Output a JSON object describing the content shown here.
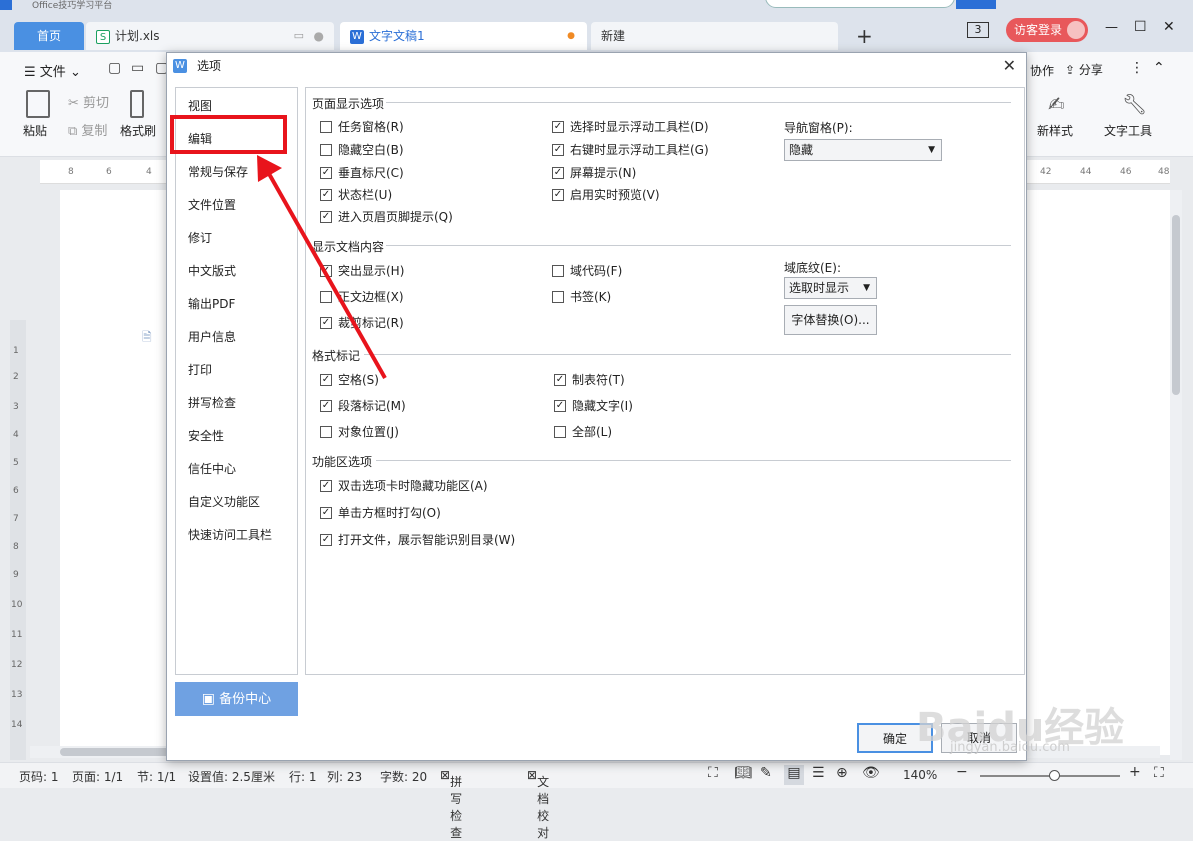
{
  "titlebar": {
    "logo_text": "Office技巧学习平台",
    "tabs": [
      {
        "label": "首页"
      },
      {
        "label": "计划.xls"
      },
      {
        "label": "文字文稿1"
      },
      {
        "label": "新建"
      }
    ],
    "new_tab": "+",
    "page_count": "3",
    "login": "访客登录",
    "minimize": "—",
    "maximize": "☐",
    "close": "✕"
  },
  "toolbar": {
    "file_menu": "文件",
    "paste": "粘贴",
    "cut": "剪切",
    "copy": "复制",
    "format_painter": "格式刷",
    "collab": "协作",
    "share": "分享",
    "new_style": "新样式",
    "text_tools": "文字工具"
  },
  "ruler": {
    "ticks": [
      "8",
      "6",
      "4",
      "42",
      "44",
      "46",
      "48"
    ]
  },
  "left_ruler": {
    "ticks": [
      "1",
      "2",
      "3",
      "4",
      "5",
      "6",
      "7",
      "8",
      "9",
      "10",
      "11",
      "12",
      "13",
      "14"
    ]
  },
  "dialog": {
    "title": "选项",
    "close": "✕",
    "nav_items": [
      "视图",
      "编辑",
      "常规与保存",
      "文件位置",
      "修订",
      "中文版式",
      "输出PDF",
      "用户信息",
      "打印",
      "拼写检查",
      "安全性",
      "信任中心",
      "自定义功能区",
      "快速访问工具栏"
    ],
    "backup_button": "备份中心",
    "sections": {
      "page_display": "页面显示选项",
      "doc_content": "显示文档内容",
      "format_marks": "格式标记",
      "ribbon_options": "功能区选项"
    },
    "page_display_options": [
      {
        "label": "任务窗格(R)",
        "checked": false
      },
      {
        "label": "隐藏空白(B)",
        "checked": false
      },
      {
        "label": "垂直标尺(C)",
        "checked": true
      },
      {
        "label": "状态栏(U)",
        "checked": true
      },
      {
        "label": "进入页眉页脚提示(Q)",
        "checked": true
      },
      {
        "label": "选择时显示浮动工具栏(D)",
        "checked": true
      },
      {
        "label": "右键时显示浮动工具栏(G)",
        "checked": true
      },
      {
        "label": "屏幕提示(N)",
        "checked": true
      },
      {
        "label": "启用实时预览(V)",
        "checked": true
      }
    ],
    "nav_pane_label": "导航窗格(P):",
    "nav_pane_value": "隐藏",
    "doc_content_options": [
      {
        "label": "突出显示(H)",
        "checked": true
      },
      {
        "label": "正文边框(X)",
        "checked": false
      },
      {
        "label": "裁剪标记(R)",
        "checked": true
      },
      {
        "label": "域代码(F)",
        "checked": false
      },
      {
        "label": "书签(K)",
        "checked": false
      }
    ],
    "field_shading_label": "域底纹(E):",
    "field_shading_value": "选取时显示",
    "font_replace_button": "字体替换(O)...",
    "format_marks_options": [
      {
        "label": "空格(S)",
        "checked": true
      },
      {
        "label": "段落标记(M)",
        "checked": true
      },
      {
        "label": "对象位置(J)",
        "checked": false
      },
      {
        "label": "制表符(T)",
        "checked": true
      },
      {
        "label": "隐藏文字(I)",
        "checked": true
      },
      {
        "label": "全部(L)",
        "checked": false
      }
    ],
    "ribbon_options": [
      {
        "label": "双击选项卡时隐藏功能区(A)",
        "checked": true
      },
      {
        "label": "单击方框时打勾(O)",
        "checked": true
      },
      {
        "label": "打开文件，展示智能识别目录(W)",
        "checked": true
      }
    ],
    "ok": "确定",
    "cancel": "取消"
  },
  "statusbar": {
    "page_num": "页码: 1",
    "page": "页面: 1/1",
    "section": "节: 1/1",
    "setting": "设置值: 2.5厘米",
    "row": "行: 1",
    "col": "列: 23",
    "words": "字数: 20",
    "spell": "拼写检查",
    "proof": "文档校对",
    "zoom": "140%"
  },
  "watermark": "Baidu经验",
  "watermark_url": "jingyan.baidu.com",
  "check_mark": "✓",
  "colors": {
    "accent": "#4a90e2",
    "annotation": "#e8141c"
  }
}
